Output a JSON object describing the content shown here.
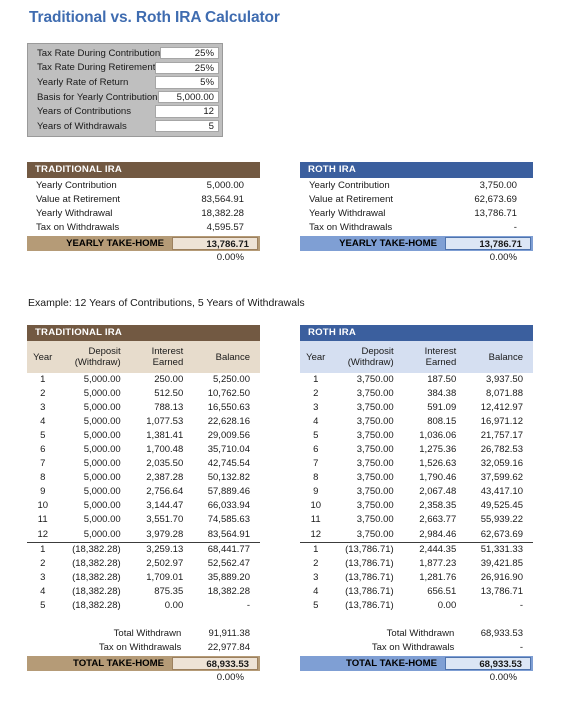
{
  "title": "Traditional vs. Roth IRA Calculator",
  "inputs": {
    "rows": [
      {
        "label": "Tax Rate During Contribution",
        "value": "25%"
      },
      {
        "label": "Tax Rate During Retirement",
        "value": "25%"
      },
      {
        "label": "Yearly Rate of Return",
        "value": "5%"
      },
      {
        "label": "Basis for Yearly Contribution",
        "value": "5,000.00"
      },
      {
        "label": "Years of Contributions",
        "value": "12"
      },
      {
        "label": "Years of Withdrawals",
        "value": "5"
      }
    ]
  },
  "summary": {
    "traditional": {
      "header": "TRADITIONAL IRA",
      "rows": [
        {
          "label": "Yearly Contribution",
          "value": "5,000.00"
        },
        {
          "label": "Value at Retirement",
          "value": "83,564.91"
        },
        {
          "label": "Yearly Withdrawal",
          "value": "18,382.28"
        },
        {
          "label": "Tax on Withdrawals",
          "value": "4,595.57"
        }
      ],
      "takehome_label": "YEARLY TAKE-HOME",
      "takehome_value": "13,786.71",
      "percent": "0.00%"
    },
    "roth": {
      "header": "ROTH IRA",
      "rows": [
        {
          "label": "Yearly Contribution",
          "value": "3,750.00"
        },
        {
          "label": "Value at Retirement",
          "value": "62,673.69"
        },
        {
          "label": "Yearly Withdrawal",
          "value": "13,786.71"
        },
        {
          "label": "Tax on Withdrawals",
          "value": "-"
        }
      ],
      "takehome_label": "YEARLY TAKE-HOME",
      "takehome_value": "13,786.71",
      "percent": "0.00%"
    }
  },
  "example_caption": "Example: 12 Years of Contributions, 5 Years of Withdrawals",
  "schedule": {
    "columns": [
      "Year",
      "Deposit (Withdraw)",
      "Interest Earned",
      "Balance"
    ],
    "column_lines": [
      [
        "Year",
        ""
      ],
      [
        "Deposit",
        "(Withdraw)"
      ],
      [
        "Interest",
        "Earned"
      ],
      [
        "Balance",
        ""
      ]
    ],
    "traditional": {
      "header": "TRADITIONAL IRA",
      "contribution_rows": [
        {
          "year": "1",
          "deposit": "5,000.00",
          "interest": "250.00",
          "balance": "5,250.00"
        },
        {
          "year": "2",
          "deposit": "5,000.00",
          "interest": "512.50",
          "balance": "10,762.50"
        },
        {
          "year": "3",
          "deposit": "5,000.00",
          "interest": "788.13",
          "balance": "16,550.63"
        },
        {
          "year": "4",
          "deposit": "5,000.00",
          "interest": "1,077.53",
          "balance": "22,628.16"
        },
        {
          "year": "5",
          "deposit": "5,000.00",
          "interest": "1,381.41",
          "balance": "29,009.56"
        },
        {
          "year": "6",
          "deposit": "5,000.00",
          "interest": "1,700.48",
          "balance": "35,710.04"
        },
        {
          "year": "7",
          "deposit": "5,000.00",
          "interest": "2,035.50",
          "balance": "42,745.54"
        },
        {
          "year": "8",
          "deposit": "5,000.00",
          "interest": "2,387.28",
          "balance": "50,132.82"
        },
        {
          "year": "9",
          "deposit": "5,000.00",
          "interest": "2,756.64",
          "balance": "57,889.46"
        },
        {
          "year": "10",
          "deposit": "5,000.00",
          "interest": "3,144.47",
          "balance": "66,033.94"
        },
        {
          "year": "11",
          "deposit": "5,000.00",
          "interest": "3,551.70",
          "balance": "74,585.63"
        },
        {
          "year": "12",
          "deposit": "5,000.00",
          "interest": "3,979.28",
          "balance": "83,564.91"
        }
      ],
      "withdrawal_rows": [
        {
          "year": "1",
          "deposit": "(18,382.28)",
          "interest": "3,259.13",
          "balance": "68,441.77"
        },
        {
          "year": "2",
          "deposit": "(18,382.28)",
          "interest": "2,502.97",
          "balance": "52,562.47"
        },
        {
          "year": "3",
          "deposit": "(18,382.28)",
          "interest": "1,709.01",
          "balance": "35,889.20"
        },
        {
          "year": "4",
          "deposit": "(18,382.28)",
          "interest": "875.35",
          "balance": "18,382.28"
        },
        {
          "year": "5",
          "deposit": "(18,382.28)",
          "interest": "0.00",
          "balance": "-"
        }
      ],
      "total_withdrawn_label": "Total Withdrawn",
      "total_withdrawn_value": "91,911.38",
      "tax_label": "Tax on Withdrawals",
      "tax_value": "22,977.84",
      "total_takehome_label": "TOTAL TAKE-HOME",
      "total_takehome_value": "68,933.53",
      "percent": "0.00%"
    },
    "roth": {
      "header": "ROTH IRA",
      "contribution_rows": [
        {
          "year": "1",
          "deposit": "3,750.00",
          "interest": "187.50",
          "balance": "3,937.50"
        },
        {
          "year": "2",
          "deposit": "3,750.00",
          "interest": "384.38",
          "balance": "8,071.88"
        },
        {
          "year": "3",
          "deposit": "3,750.00",
          "interest": "591.09",
          "balance": "12,412.97"
        },
        {
          "year": "4",
          "deposit": "3,750.00",
          "interest": "808.15",
          "balance": "16,971.12"
        },
        {
          "year": "5",
          "deposit": "3,750.00",
          "interest": "1,036.06",
          "balance": "21,757.17"
        },
        {
          "year": "6",
          "deposit": "3,750.00",
          "interest": "1,275.36",
          "balance": "26,782.53"
        },
        {
          "year": "7",
          "deposit": "3,750.00",
          "interest": "1,526.63",
          "balance": "32,059.16"
        },
        {
          "year": "8",
          "deposit": "3,750.00",
          "interest": "1,790.46",
          "balance": "37,599.62"
        },
        {
          "year": "9",
          "deposit": "3,750.00",
          "interest": "2,067.48",
          "balance": "43,417.10"
        },
        {
          "year": "10",
          "deposit": "3,750.00",
          "interest": "2,358.35",
          "balance": "49,525.45"
        },
        {
          "year": "11",
          "deposit": "3,750.00",
          "interest": "2,663.77",
          "balance": "55,939.22"
        },
        {
          "year": "12",
          "deposit": "3,750.00",
          "interest": "2,984.46",
          "balance": "62,673.69"
        }
      ],
      "withdrawal_rows": [
        {
          "year": "1",
          "deposit": "(13,786.71)",
          "interest": "2,444.35",
          "balance": "51,331.33"
        },
        {
          "year": "2",
          "deposit": "(13,786.71)",
          "interest": "1,877.23",
          "balance": "39,421.85"
        },
        {
          "year": "3",
          "deposit": "(13,786.71)",
          "interest": "1,281.76",
          "balance": "26,916.90"
        },
        {
          "year": "4",
          "deposit": "(13,786.71)",
          "interest": "656.51",
          "balance": "13,786.71"
        },
        {
          "year": "5",
          "deposit": "(13,786.71)",
          "interest": "0.00",
          "balance": "-"
        }
      ],
      "total_withdrawn_label": "Total Withdrawn",
      "total_withdrawn_value": "68,933.53",
      "tax_label": "Tax on Withdrawals",
      "tax_value": "-",
      "total_takehome_label": "TOTAL TAKE-HOME",
      "total_takehome_value": "68,933.53",
      "percent": "0.00%"
    }
  },
  "colors": {
    "title": "#3f6cb0",
    "traditional_header": "#725942",
    "roth_header": "#3b5f9e",
    "traditional_band": "#b59b77",
    "roth_band": "#7f9fd4",
    "traditional_colhead": "#e7dccc",
    "roth_colhead": "#d5dff1",
    "input_panel": "#bfbfbf"
  }
}
